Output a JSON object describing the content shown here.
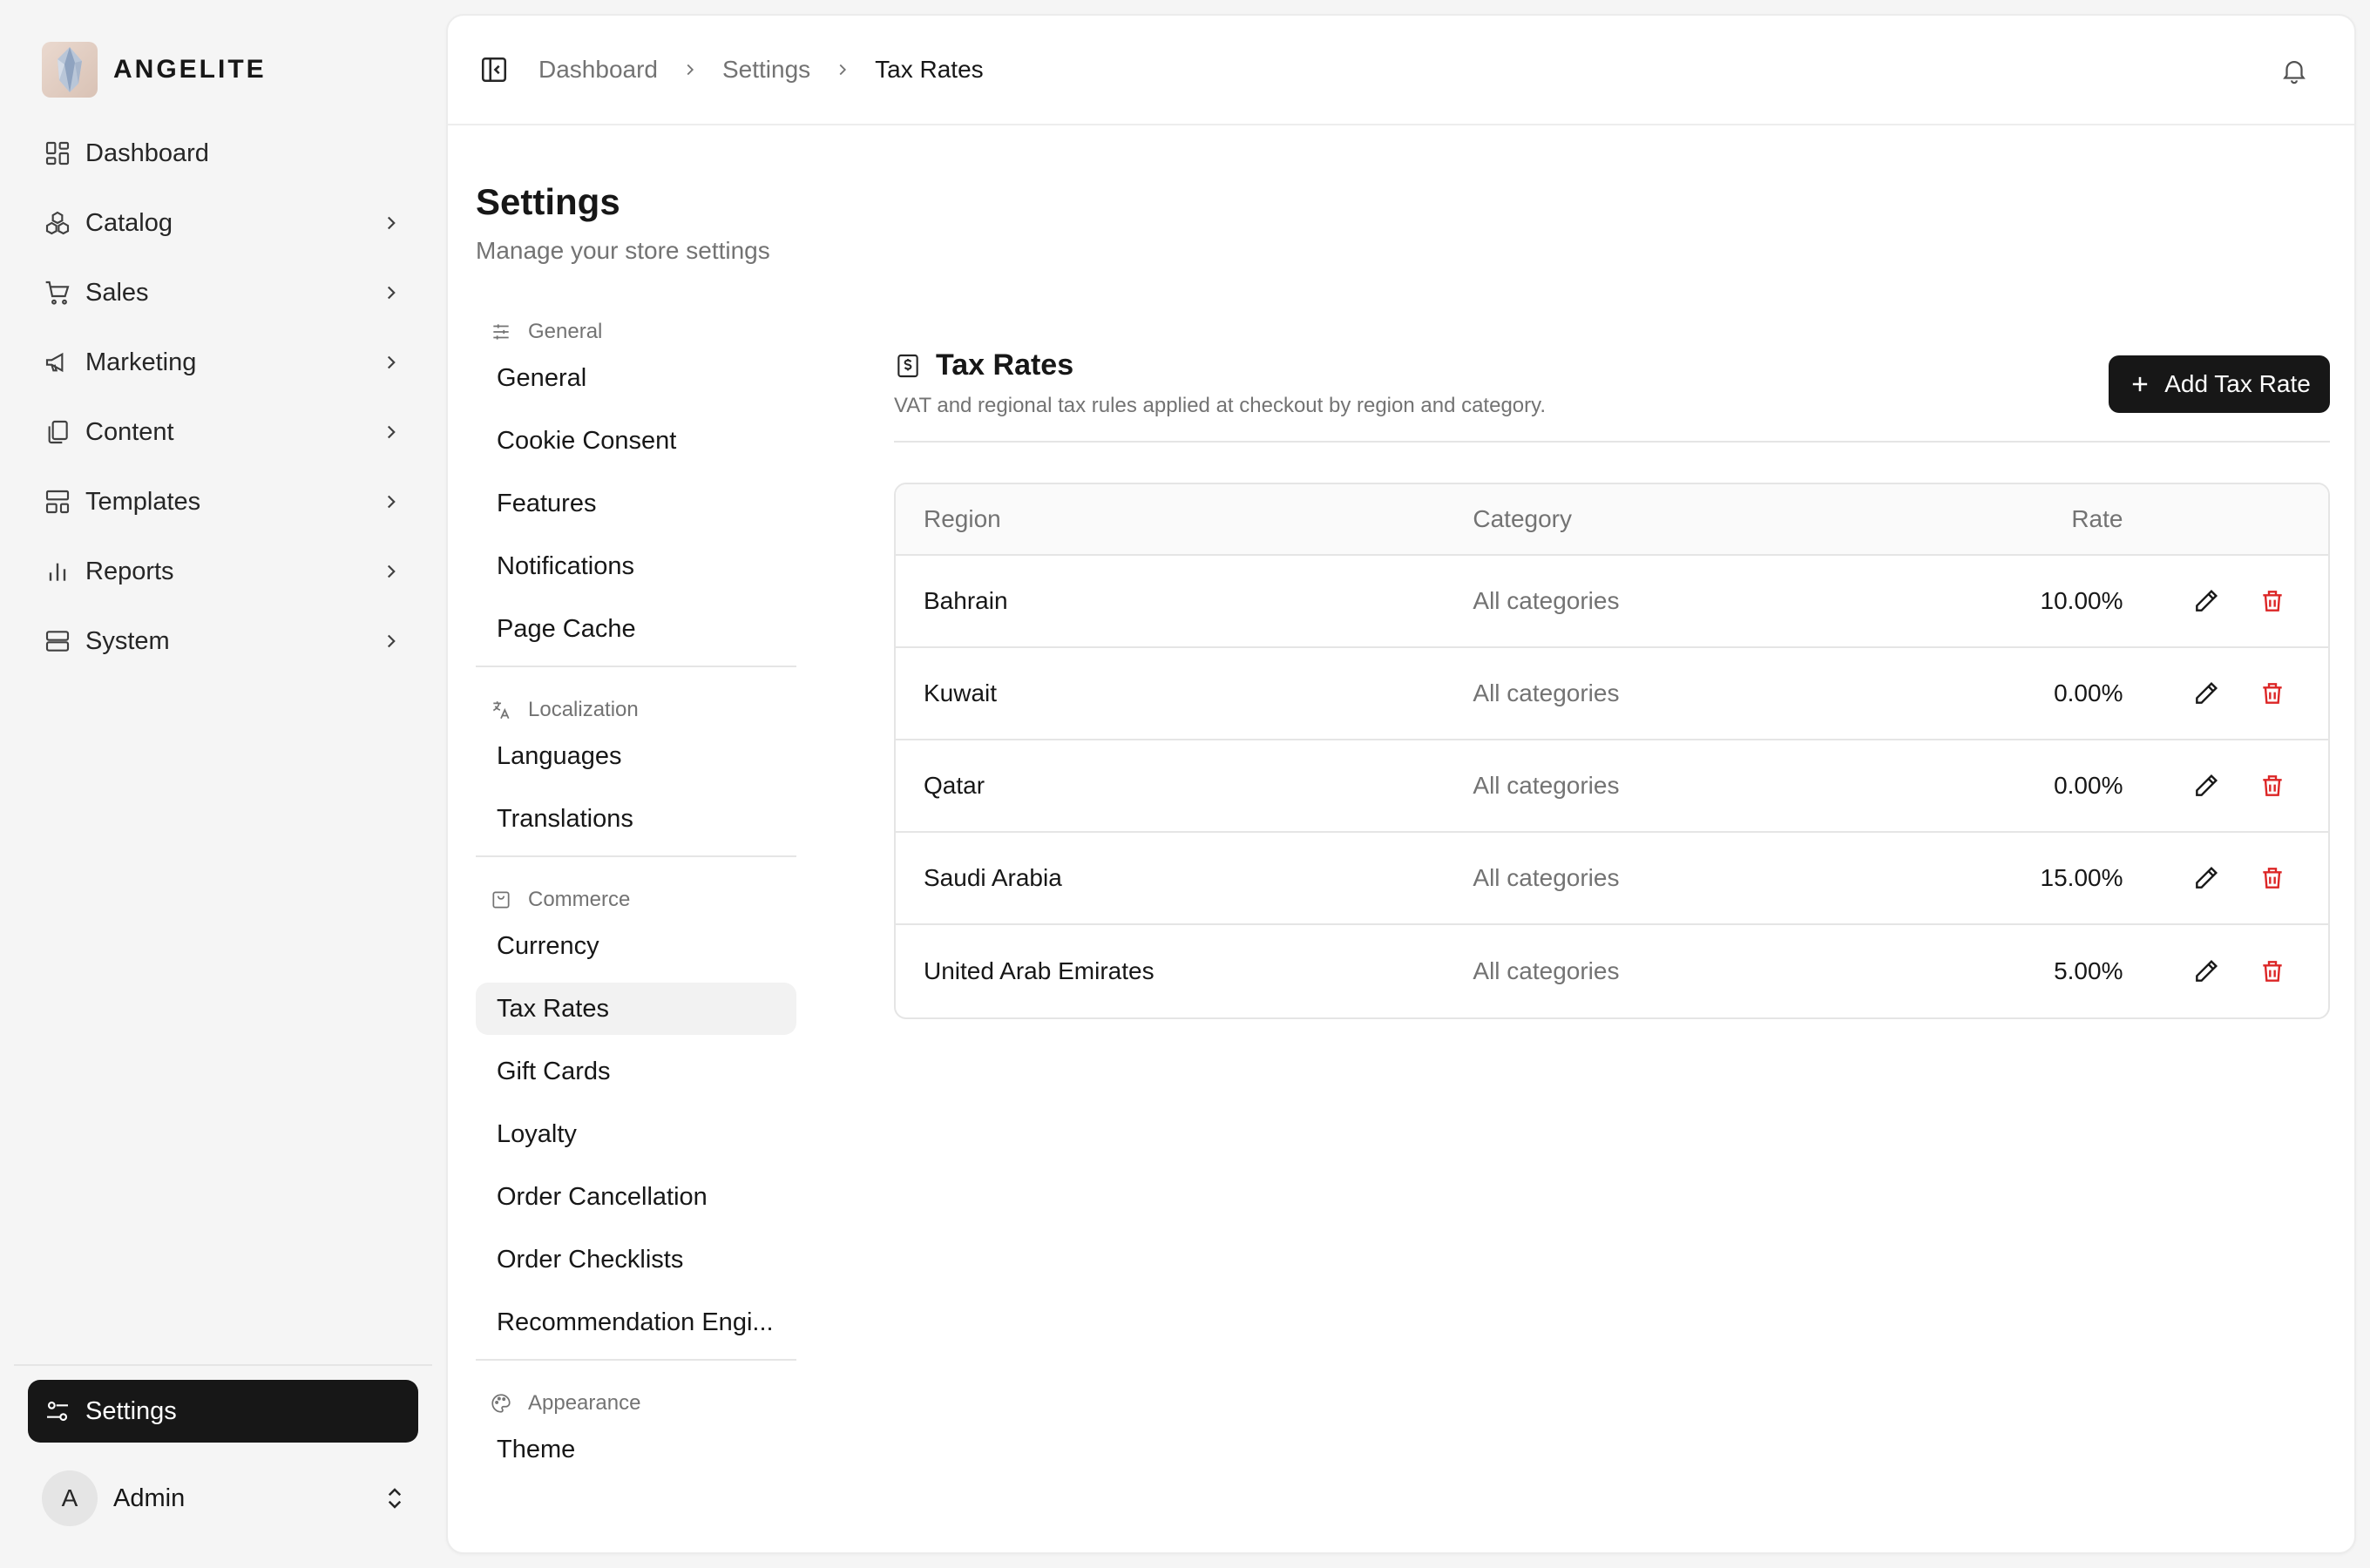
{
  "brand": {
    "name": "ANGELITE"
  },
  "nav": {
    "items": [
      {
        "label": "Dashboard",
        "icon": "dashboard-icon",
        "has_chevron": false
      },
      {
        "label": "Catalog",
        "icon": "catalog-icon",
        "has_chevron": true
      },
      {
        "label": "Sales",
        "icon": "cart-icon",
        "has_chevron": true
      },
      {
        "label": "Marketing",
        "icon": "megaphone-icon",
        "has_chevron": true
      },
      {
        "label": "Content",
        "icon": "files-icon",
        "has_chevron": true
      },
      {
        "label": "Templates",
        "icon": "layout-icon",
        "has_chevron": true
      },
      {
        "label": "Reports",
        "icon": "bar-chart-icon",
        "has_chevron": true
      },
      {
        "label": "System",
        "icon": "server-icon",
        "has_chevron": true
      }
    ],
    "settings_label": "Settings"
  },
  "user": {
    "initial": "A",
    "name": "Admin"
  },
  "breadcrumb": {
    "items": [
      "Dashboard",
      "Settings"
    ],
    "current": "Tax Rates"
  },
  "page": {
    "title": "Settings",
    "subtitle": "Manage your store settings"
  },
  "subnav": {
    "groups": [
      {
        "heading": "General",
        "icon": "sliders-icon",
        "items": [
          "General",
          "Cookie Consent",
          "Features",
          "Notifications",
          "Page Cache"
        ]
      },
      {
        "heading": "Localization",
        "icon": "translate-icon",
        "items": [
          "Languages",
          "Translations"
        ]
      },
      {
        "heading": "Commerce",
        "icon": "shopping-bag-icon",
        "items": [
          "Currency",
          "Tax Rates",
          "Gift Cards",
          "Loyalty",
          "Order Cancellation",
          "Order Checklists",
          "Recommendation Engi..."
        ]
      },
      {
        "heading": "Appearance",
        "icon": "palette-icon",
        "items": [
          "Theme"
        ]
      }
    ],
    "active": "Tax Rates"
  },
  "tax": {
    "title": "Tax Rates",
    "description": "VAT and regional tax rules applied at checkout by region and category.",
    "add_label": "Add Tax Rate",
    "columns": {
      "region": "Region",
      "category": "Category",
      "rate": "Rate"
    },
    "rows": [
      {
        "region": "Bahrain",
        "category": "All categories",
        "rate": "10.00%"
      },
      {
        "region": "Kuwait",
        "category": "All categories",
        "rate": "0.00%"
      },
      {
        "region": "Qatar",
        "category": "All categories",
        "rate": "0.00%"
      },
      {
        "region": "Saudi Arabia",
        "category": "All categories",
        "rate": "15.00%"
      },
      {
        "region": "United Arab Emirates",
        "category": "All categories",
        "rate": "5.00%"
      }
    ]
  },
  "colors": {
    "primary": "#171717",
    "danger": "#dc2626",
    "muted": "#737373",
    "background": "#f5f5f5"
  }
}
